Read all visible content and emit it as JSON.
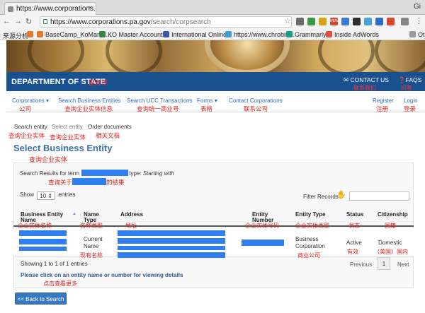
{
  "browser": {
    "tab_title": "https://www.corporations.pa.g",
    "tab_close": "×",
    "profile": "Gi",
    "url_host": "https://www.corporations.pa.gov",
    "url_path": "/search/corpsearch",
    "extension_badge": "NEW"
  },
  "bookmarks": [
    {
      "label": "来源分析"
    },
    {
      "label": "BaseCamp_KoMarke..."
    },
    {
      "label": "KO Master Account..."
    },
    {
      "label": "International Online..."
    },
    {
      "label": "https://www.chrobin..."
    },
    {
      "label": "Grammarly"
    },
    {
      "label": "Inside AdWords"
    },
    {
      "label": "Oth"
    }
  ],
  "header": {
    "title": "DEPARTMENT OF STATE",
    "title_cn": "国务院",
    "contact": "CONTACT US",
    "contact_cn": "联系我们",
    "faqs": "FAQS",
    "faqs_cn": "问答"
  },
  "nav": [
    {
      "label": "Corporations",
      "cn": "公司"
    },
    {
      "label": "Search Business Entities",
      "cn": "查询企业实体信息"
    },
    {
      "label": "Search UCC Transactions",
      "cn": "查询统一商业号"
    },
    {
      "label": "Forms",
      "cn": "表格"
    },
    {
      "label": "Contact Corporations",
      "cn": "联系公司"
    },
    {
      "label": "Register",
      "cn": "注册"
    },
    {
      "label": "Login",
      "cn": "登录"
    }
  ],
  "breadcrumb": [
    {
      "label": "Search entity",
      "cn": "查询企业实体"
    },
    {
      "label": "Select entity",
      "cn": "查询企业实体"
    },
    {
      "label": "Order documents",
      "cn": "相关文档"
    }
  ],
  "page": {
    "title": "Select Business Entity",
    "title_cn": "查询企业实体"
  },
  "results": {
    "prefix": "Search Results for term",
    "type_label": "type:",
    "type_value": "Starting with",
    "cn_before": "查询关于",
    "cn_after": "的结果",
    "show": "Show",
    "show_value": "10",
    "entries": "entries",
    "filter_label": "Filter Records"
  },
  "table": {
    "columns": [
      {
        "label": "Business Entity Name",
        "cn": "企业实体名称"
      },
      {
        "label": "Name Type",
        "cn": "名称类型"
      },
      {
        "label": "Address",
        "cn": "地址"
      },
      {
        "label": "Entity Number",
        "cn": "企业实体号码"
      },
      {
        "label": "Entity Type",
        "cn": "企业实体类型"
      },
      {
        "label": "Status",
        "cn": "状态"
      },
      {
        "label": "Citizenship",
        "cn": "国籍"
      }
    ],
    "row": {
      "name_type": "Current Name",
      "name_type_cn": "现有名称",
      "entity_type": "Business Corporation",
      "entity_type_cn": "商业公司",
      "status": "Active",
      "status_cn": "有效",
      "citizenship": "Domestic",
      "citizenship_cn": "（美国）国内"
    }
  },
  "footer": {
    "showing": "Showing 1 to 1 of 1 entries",
    "previous": "Previous",
    "page": "1",
    "next": "Next",
    "hint": "Please click on an entity name or number for viewing details",
    "hint_cn": "点击查看更多",
    "back": "<< Back to Search"
  },
  "colors": {
    "header_blue": "#19508f",
    "link_blue": "#2e6fb7",
    "annotation_red": "#e0201a",
    "redaction_blue": "#2f7ff0"
  }
}
